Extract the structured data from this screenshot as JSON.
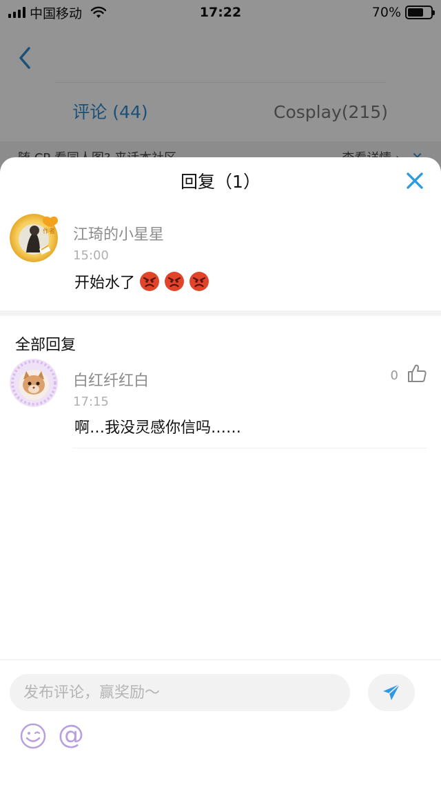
{
  "status_bar": {
    "carrier": "中国移动",
    "time": "17:22",
    "battery_percent": "70%",
    "battery_level": 0.7
  },
  "background": {
    "tabs": [
      {
        "label": "评论 (44)",
        "active": true
      },
      {
        "label": "Cosplay(215)",
        "active": false
      }
    ],
    "notice_text": "随 CP 看同人图? 来话本社区",
    "notice_more": "查看详情 ›",
    "notice_close": "✕"
  },
  "sheet": {
    "title": "回复（1）",
    "main_comment": {
      "user_name": "江琦的小星星",
      "badge": "作者",
      "time": "15:00",
      "text": "开始水了",
      "emoji_count": 3
    },
    "all_replies_label": "全部回复",
    "replies": [
      {
        "user_name": "白红纤红白",
        "time": "17:15",
        "text": "啊…我没灵感你信吗……",
        "like_count": "0"
      }
    ]
  },
  "input_bar": {
    "placeholder": "发布评论，赢奖励～",
    "at_symbol": "@"
  },
  "colors": {
    "accent_blue": "#2f8ccf",
    "emoji_purple": "#b79fe0",
    "overlay": "rgba(0,0,0,0.42)"
  }
}
